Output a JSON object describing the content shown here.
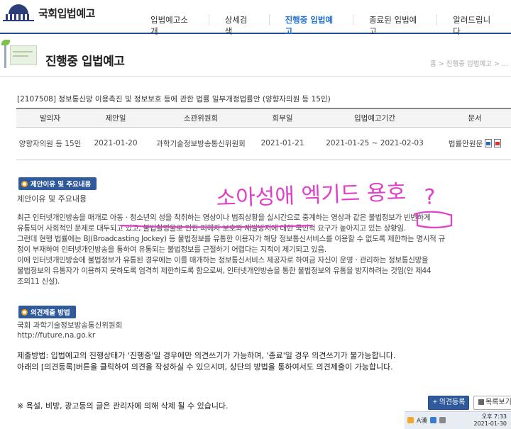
{
  "site": {
    "logo_text": "국회입법예고"
  },
  "nav": [
    {
      "label": "입법예고소개",
      "active": false
    },
    {
      "label": "상세검색",
      "active": false
    },
    {
      "label": "진행중 입법예고",
      "active": true
    },
    {
      "label": "종료된 입법예고",
      "active": false
    },
    {
      "label": "알려드립니다",
      "active": false
    }
  ],
  "page": {
    "title": "진행중 입법예고",
    "breadcrumb": "홈 > 진행중 입법예고 > ..."
  },
  "bill": {
    "title": "[2107508] 정보통신망 이용촉진 및 정보보호 등에 관한 법률 일부개정법률안 (양향자의원 등 15인)"
  },
  "table": {
    "headers": [
      "발의자",
      "제안일",
      "소관위원회",
      "회부일",
      "입법예고기간",
      "문서"
    ],
    "row": {
      "proposer": "양향자의원 등 15인",
      "proposal_date": "2021-01-20",
      "committee": "과학기술정보방송통신위원회",
      "referral_date": "2021-01-21",
      "period": "2021-01-25 ~ 2021-02-03",
      "doc_label": "법률안원문"
    }
  },
  "section1": {
    "badge": "제안이유 및 주요내용",
    "subtitle": "제안이유 및 주요내용",
    "paragraphs": [
      "최근 인터넷개인방송을 매개로 아동ㆍ청소년의 성을 착취하는 영상이나 범죄상황을 실시간으로 중계하는 영상과 같은 불법정보가 빈번하게",
      "유통되어 사회적인 문제로 대두되고 있고, 불법촬영물로 인한 피해자 보호와 재발방지에 대한 국민적 요구가 높아지고 있는 상황임.",
      "그런데 현행 법률에는 BJ(Broadcasting Jockey) 등 불법정보를 유통한 이용자가 해당 정보통신서비스를 이용할 수 없도록 제한하는 명시적 규",
      "정이 부재하여 인터넷개인방송을 통하여 유통되는 불법정보를 근절하기 어렵다는 지적이 제기되고 있음.",
      "이에 인터넷개인방송에 불법정보가 유통된 경우에는 이를 매개하는 정보통신서비스 제공자로 하여금 자신이 운영ㆍ관리하는 정보통신망을",
      "불법정보의 유통자가 이용하지 못하도록 엄격히 제한하도록 함으로써, 인터넷개인방송을 통한 불법정보의 유통을 방지하려는 것임(안 제44",
      "조의11 신설)."
    ]
  },
  "section2": {
    "badge": "의견제출 방법",
    "org_name": "국회 과학기술정보방송통신위원회",
    "org_url": "http://future.na.go.kr",
    "notice_lines": [
      "제출방법: 입법예고의 진행상태가 '진행중'일 경우에만 의견쓰기가 가능하며, '종료'일 경우 의견쓰기가 불가능합니다.",
      "아래의 [의견등록]버튼을 클릭하여 의견을 작성하실 수 있으시며, 상단의 방법을 통하여서도 의견제출이 가능합니다."
    ]
  },
  "footer": {
    "note": "※ 욕설, 비방, 광고등의 글은 관리자에 의해 삭제 될 수 있습니다.",
    "opinion_button": "+ 의견등록",
    "list_button": "목록보기"
  },
  "annotation": {
    "handwriting": "소아성애 엑기드 용호",
    "mark": "?",
    "color": "#e040c8"
  },
  "taskbar": {
    "ime": "A漢",
    "time": "오후 7:33",
    "date": "2021-01-30"
  }
}
